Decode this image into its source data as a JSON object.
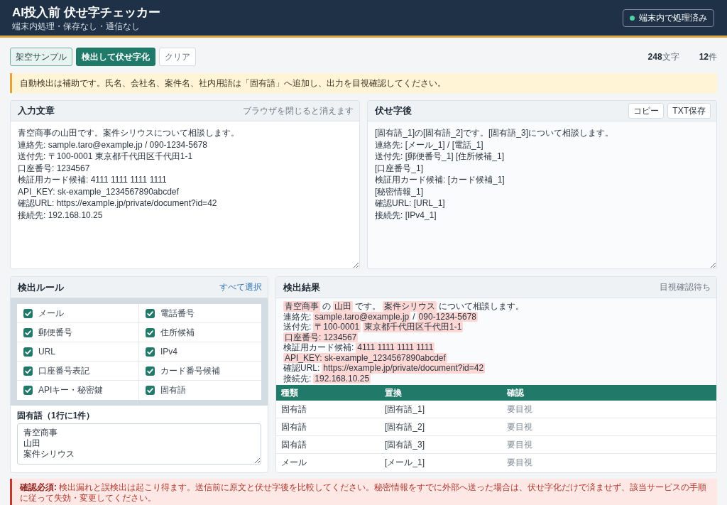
{
  "header": {
    "title": "AI投入前 伏せ字チェッカー",
    "subtitle": "端末内処理・保存なし・通信なし",
    "badge": {
      "label": "端末内で処理済み"
    }
  },
  "toolbar": {
    "buttons": [
      {
        "label": "架空サンプル",
        "kind": "tinted"
      },
      {
        "label": "検出して伏せ字化",
        "kind": "primary"
      },
      {
        "label": "クリア",
        "kind": "plain"
      }
    ],
    "char_count": "**248**文字",
    "match_count": "**12**件"
  },
  "notice": "自動検出は補助です。氏名、会社名、案件名、社内用語は「固有語」へ追加し、出力を目視確認してください。",
  "input_panel": {
    "title": "入力文章",
    "note": "ブラウザを閉じると消えます",
    "value": [
      "青空商事の山田です。案件シリウスについて相談します。",
      "連絡先: sample.taro@example.jp / 090-1234-5678",
      "送付先: 〒100-0001 東京都千代田区千代田1-1",
      "口座番号: 1234567",
      "検証用カード候補: 4111 1111 1111 1111",
      "API_KEY: sk-example_1234567890abcdef",
      "確認URL: https://example.jp/private/document?id=42",
      "接続先: 192.168.10.25"
    ]
  },
  "output_panel": {
    "title": "伏せ字後",
    "buttons": [
      "コピー",
      "TXT保存"
    ],
    "value": [
      "[固有語_1]の[固有語_2]です。[固有語_3]について相談します。",
      "連絡先: [メール_1] / [電話_1]",
      "送付先: [郵便番号_1] [住所候補_1]",
      "[口座番号_1]",
      "検証用カード候補: [カード候補_1]",
      "[秘密情報_1]",
      "確認URL: [URL_1]",
      "接続先: [IPv4_1]"
    ]
  },
  "rules_panel": {
    "title": "検出ルール",
    "link": "すべて選択",
    "rules": [
      {
        "label": "メール",
        "checked": true
      },
      {
        "label": "電話番号",
        "checked": true
      },
      {
        "label": "郵便番号",
        "checked": true
      },
      {
        "label": "住所候補",
        "checked": true
      },
      {
        "label": "URL",
        "checked": true
      },
      {
        "label": "IPv4",
        "checked": true
      },
      {
        "label": "口座番号表記",
        "checked": true
      },
      {
        "label": "カード番号候補",
        "checked": true
      },
      {
        "label": "APIキー・秘密鍵",
        "checked": true
      },
      {
        "label": "固有語",
        "checked": true
      }
    ],
    "terms": {
      "label": "固有語（1行に1件）",
      "value": [
        "青空商事",
        "山田",
        "案件シリウス"
      ]
    }
  },
  "results_panel": {
    "title": "検出結果",
    "status": "目視確認待ち",
    "preview": [
      {
        "segments": [
          {
            "text": "青空商事",
            "matched": true
          },
          {
            "text": "の",
            "matched": false
          },
          {
            "text": "山田",
            "matched": true
          },
          {
            "text": "です。",
            "matched": false
          },
          {
            "text": "案件シリウス",
            "matched": true
          },
          {
            "text": "について相談します。",
            "matched": false
          }
        ]
      },
      {
        "segments": [
          {
            "text": "連絡先:",
            "matched": false
          },
          {
            "text": "sample.taro@example.jp",
            "matched": true
          },
          {
            "text": "/",
            "matched": false
          },
          {
            "text": "090-1234-5678",
            "matched": true
          }
        ]
      },
      {
        "segments": [
          {
            "text": "送付先:",
            "matched": false
          },
          {
            "text": "〒100-0001",
            "matched": true
          },
          {
            "text": "東京都千代田区千代田1-1",
            "matched": true
          }
        ]
      },
      {
        "segments": [
          {
            "text": "口座番号: 1234567",
            "matched": true
          }
        ]
      },
      {
        "segments": [
          {
            "text": "検証用カード候補:",
            "matched": false
          },
          {
            "text": "4111 1111 1111 1111",
            "matched": true
          }
        ]
      },
      {
        "segments": [
          {
            "text": "API_KEY: sk-example_1234567890abcdef",
            "matched": true
          }
        ]
      },
      {
        "segments": [
          {
            "text": "確認URL:",
            "matched": false
          },
          {
            "text": "https://example.jp/private/document?id=42",
            "matched": true
          }
        ]
      },
      {
        "segments": [
          {
            "text": "接続先:",
            "matched": false
          },
          {
            "text": "192.168.10.25",
            "matched": true
          }
        ]
      }
    ],
    "table": {
      "columns": [
        "種類",
        "置換",
        "確認"
      ],
      "rows": [
        [
          "固有語",
          "[固有語_1]",
          "要目視"
        ],
        [
          "固有語",
          "[固有語_2]",
          "要目視"
        ],
        [
          "固有語",
          "[固有語_3]",
          "要目視"
        ],
        [
          "メール",
          "[メール_1]",
          "要目視"
        ]
      ]
    }
  },
  "alert": "**確認必須:** 検出漏れと誤検出は起こり得ます。送信前に原文と伏せ字後を比較してください。秘密情報をすでに外部へ送った場合は、伏せ字化だけで済ませず、該当サービスの手順に従って失効・変更してください。"
}
